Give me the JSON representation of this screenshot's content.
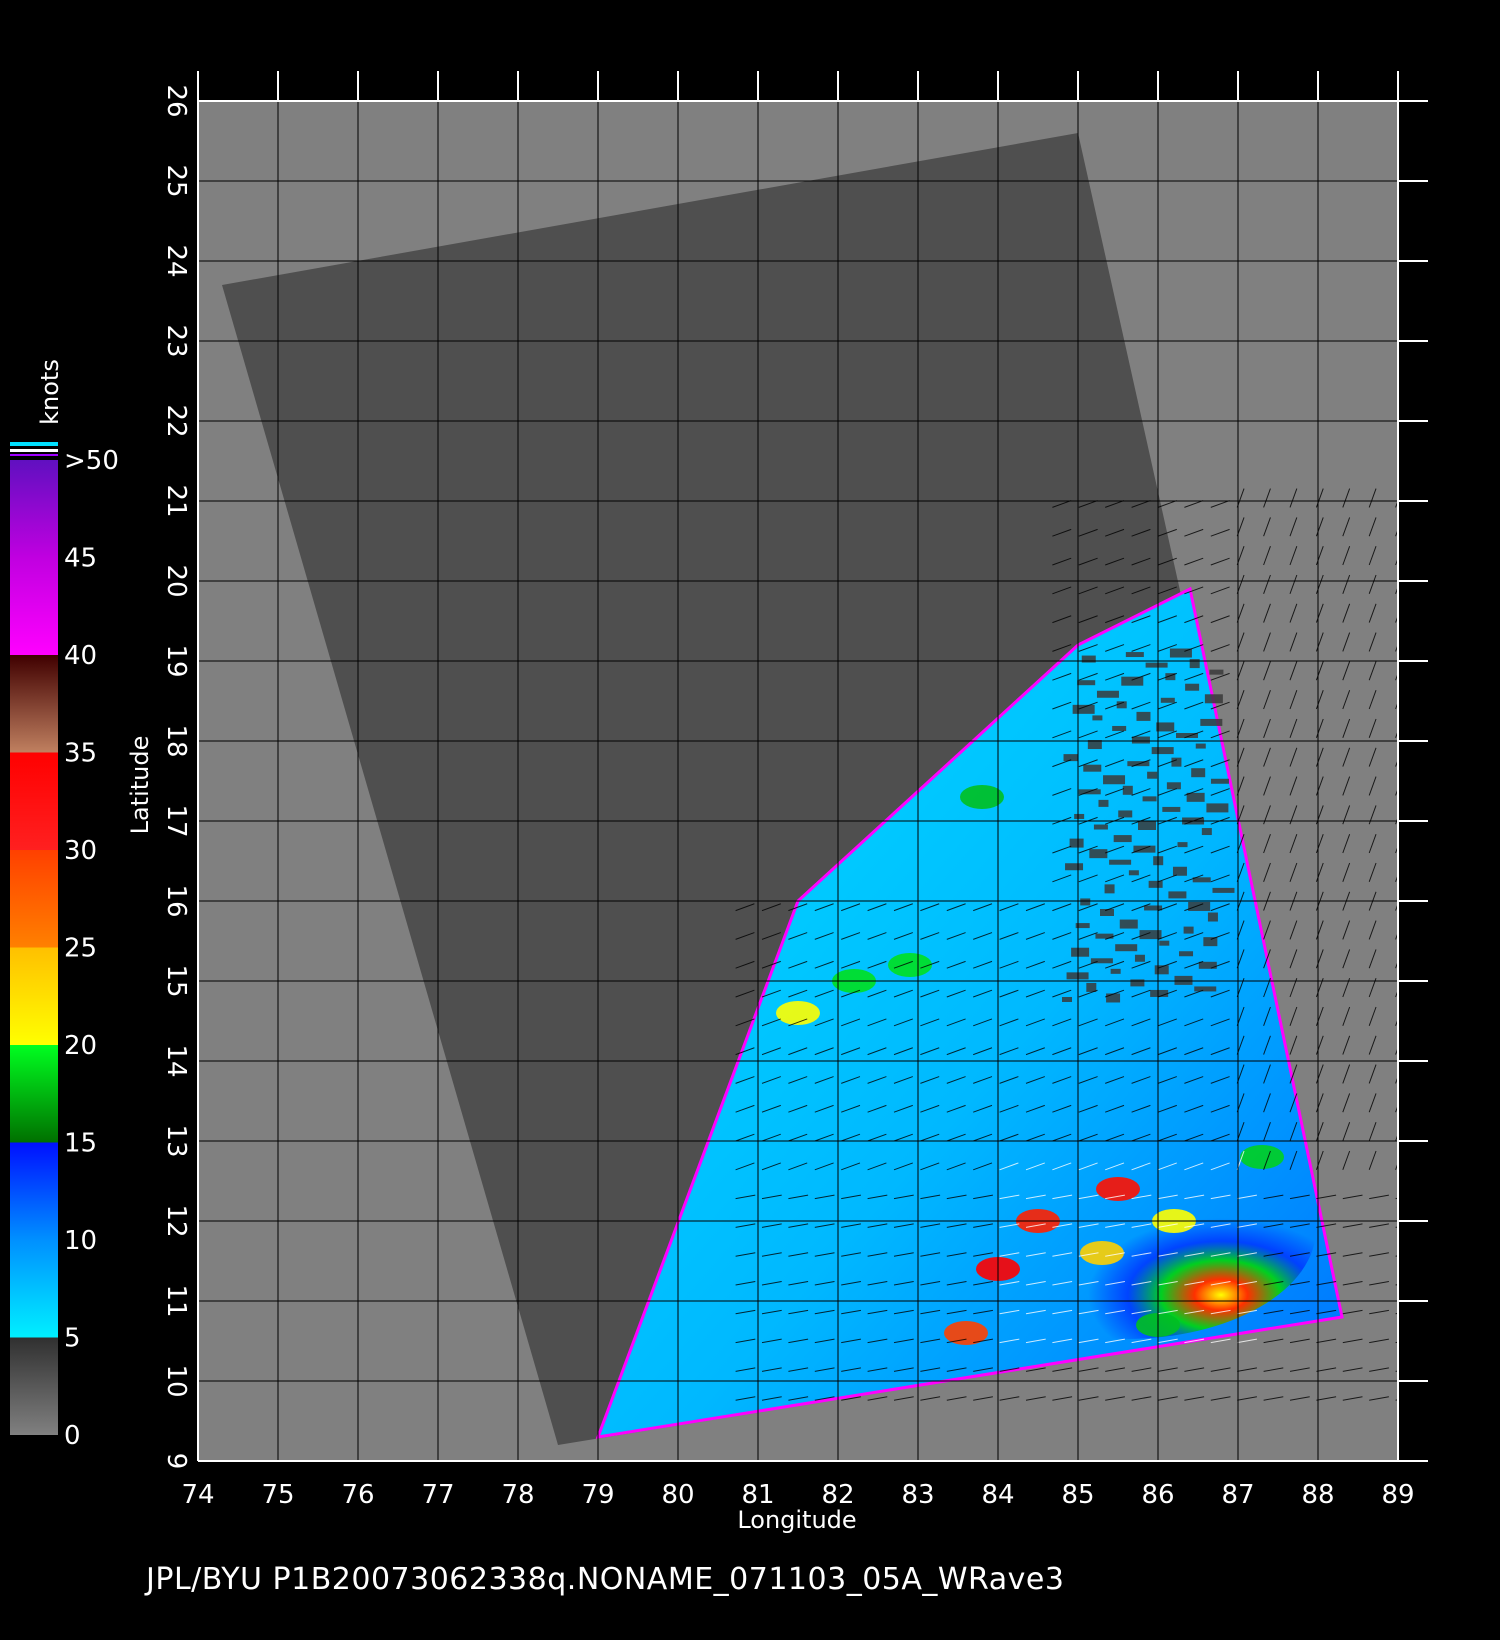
{
  "footer": {
    "caption": "JPL/BYU  P1B20073062338q.NONAME_071103_05A_WRave3"
  },
  "axes": {
    "x_label": "Longitude",
    "y_label": "Latitude",
    "lon_range": [
      74,
      89
    ],
    "lat_range": [
      9,
      26
    ],
    "lon_ticks": [
      "74",
      "75",
      "76",
      "77",
      "78",
      "79",
      "80",
      "81",
      "82",
      "83",
      "84",
      "85",
      "86",
      "87",
      "88",
      "89"
    ],
    "lat_ticks": [
      "9",
      "10",
      "11",
      "12",
      "13",
      "14",
      "15",
      "16",
      "17",
      "18",
      "19",
      "20",
      "21",
      "22",
      "23",
      "24",
      "25",
      "26"
    ],
    "grid": true
  },
  "colorbar": {
    "unit": "knots",
    "labels": [
      "0",
      "5",
      "10",
      "15",
      "20",
      "25",
      "30",
      "35",
      "40",
      "45",
      ">50"
    ],
    "stops": [
      {
        "value": 0,
        "color": "#808080"
      },
      {
        "value": 5,
        "color": "#303030"
      },
      {
        "value": 5,
        "color": "#00f0ff"
      },
      {
        "value": 10,
        "color": "#0090ff"
      },
      {
        "value": 15,
        "color": "#0010ff"
      },
      {
        "value": 15,
        "color": "#007000"
      },
      {
        "value": 20,
        "color": "#00ff20"
      },
      {
        "value": 20,
        "color": "#ffff00"
      },
      {
        "value": 25,
        "color": "#ffc000"
      },
      {
        "value": 25,
        "color": "#ff8000"
      },
      {
        "value": 30,
        "color": "#ff4000"
      },
      {
        "value": 30,
        "color": "#ff2020"
      },
      {
        "value": 35,
        "color": "#ff0000"
      },
      {
        "value": 35,
        "color": "#c08060"
      },
      {
        "value": 40,
        "color": "#400000"
      },
      {
        "value": 40,
        "color": "#ff00ff"
      },
      {
        "value": 45,
        "color": "#c000e0"
      },
      {
        "value": 50,
        "color": "#6010c0"
      }
    ]
  },
  "colors": {
    "background": "#000000",
    "map_fill": "#808080",
    "swath_fill": "#4f4f4f",
    "ocean_low": "#00e0ff",
    "ocean_mid": "#0070ff",
    "land_dark": "#3a3a3a",
    "grid": "#000000",
    "tick": "#ffffff",
    "wind_barb": "#000000"
  },
  "swath_corners_lonlat": [
    [
      74.3,
      23.7
    ],
    [
      85.0,
      25.6
    ],
    [
      88.3,
      10.8
    ],
    [
      78.5,
      9.2
    ]
  ],
  "wind_field_corners_lonlat": [
    [
      79.0,
      9.3
    ],
    [
      81.5,
      16.0
    ],
    [
      85.0,
      19.2
    ],
    [
      86.4,
      19.9
    ],
    [
      88.3,
      10.8
    ]
  ]
}
